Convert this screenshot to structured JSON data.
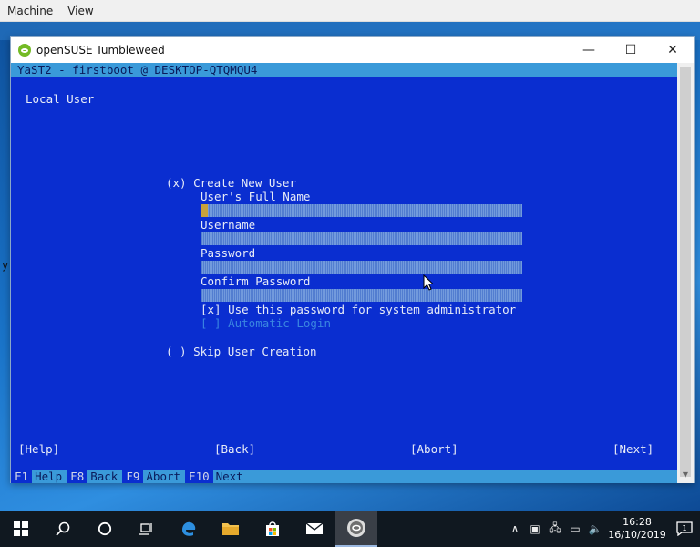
{
  "host_menu": {
    "items": [
      "Machine",
      "View"
    ]
  },
  "window": {
    "title": "openSUSE Tumbleweed",
    "minimize": "—",
    "maximize": "☐",
    "close": "✕"
  },
  "terminal": {
    "title": "YaST2 - firstboot @ DESKTOP-QTQMQU4",
    "heading": "Local User",
    "create_option": "(x) Create New User",
    "full_name_label": "User's Full Name",
    "username_label": "Username",
    "password_label": "Password",
    "confirm_password_label": "Confirm Password",
    "admin_checkbox": "[x] Use this password for system administrator",
    "autologin_checkbox": "[ ] Automatic Login",
    "skip_option": "( ) Skip User Creation",
    "buttons": {
      "help": "[Help]",
      "back": "[Back]",
      "abort": "[Abort]",
      "next": "[Next]"
    },
    "fkeys": [
      {
        "key": "F1",
        "label": "Help"
      },
      {
        "key": "F8",
        "label": "Back"
      },
      {
        "key": "F9",
        "label": "Abort"
      },
      {
        "key": "F10",
        "label": "Next"
      }
    ]
  },
  "desktop": {
    "stray_char": "y"
  },
  "taskbar": {
    "time": "16:28",
    "date": "16/10/2019",
    "notification_count": "1"
  },
  "colors": {
    "terminal_bg": "#0a2ed0",
    "terminal_bar": "#3a9ad9",
    "opensuse_green": "#73ba25"
  }
}
